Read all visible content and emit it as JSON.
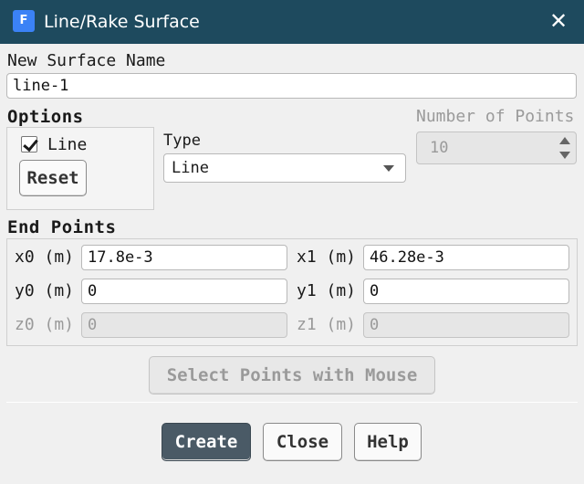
{
  "window": {
    "title": "Line/Rake Surface",
    "app_icon_letter": "F",
    "close_glyph": "✕"
  },
  "surface_name": {
    "label": "New Surface Name",
    "value": "line-1"
  },
  "options": {
    "heading": "Options",
    "line_checkbox": {
      "label": "Line",
      "checked": true
    },
    "reset_label": "Reset"
  },
  "type": {
    "label": "Type",
    "selected": "Line"
  },
  "num_points": {
    "label": "Number of Points",
    "value": "10"
  },
  "end_points": {
    "heading": "End Points",
    "x0": {
      "label": "x0 (m)",
      "value": "17.8e-3"
    },
    "x1": {
      "label": "x1 (m)",
      "value": "46.28e-3"
    },
    "y0": {
      "label": "y0 (m)",
      "value": "0"
    },
    "y1": {
      "label": "y1 (m)",
      "value": "0"
    },
    "z0": {
      "label": "z0 (m)",
      "value": "0"
    },
    "z1": {
      "label": "z1 (m)",
      "value": "0"
    }
  },
  "select_points_label": "Select Points with Mouse",
  "footer": {
    "create_label": "Create",
    "close_label": "Close",
    "help_label": "Help"
  },
  "colors": {
    "titlebar": "#1e4a5e",
    "primary_button": "#4a5a66"
  }
}
